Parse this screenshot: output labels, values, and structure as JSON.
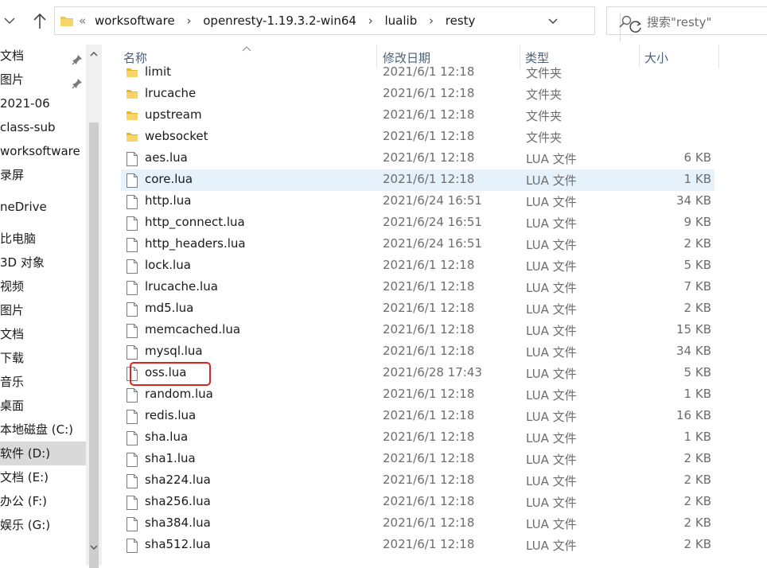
{
  "address_bar": {
    "overflow_chevron": "«",
    "crumbs": [
      "worksoftware",
      "openresty-1.19.3.2-win64",
      "lualib",
      "resty"
    ],
    "separator": "›"
  },
  "search": {
    "placeholder": "搜索\"resty\""
  },
  "navpane": {
    "items": [
      {
        "label": "文档",
        "pinned": true
      },
      {
        "label": "图片",
        "pinned": true
      },
      {
        "label": "2021-06",
        "pinned": false
      },
      {
        "label": "class-sub",
        "pinned": false
      },
      {
        "label": "worksoftware",
        "pinned": false
      },
      {
        "label": "录屏",
        "pinned": false
      },
      {
        "label": "neDrive",
        "pinned": false
      },
      {
        "label": "比电脑",
        "pinned": false
      },
      {
        "label": "3D 对象",
        "pinned": false
      },
      {
        "label": "视频",
        "pinned": false
      },
      {
        "label": "图片",
        "pinned": false
      },
      {
        "label": "文档",
        "pinned": false
      },
      {
        "label": "下载",
        "pinned": false
      },
      {
        "label": "音乐",
        "pinned": false
      },
      {
        "label": "桌面",
        "pinned": false
      },
      {
        "label": "本地磁盘 (C:)",
        "pinned": false
      },
      {
        "label": "软件 (D:)",
        "pinned": false,
        "selected": true
      },
      {
        "label": "文档 (E:)",
        "pinned": false
      },
      {
        "label": "办公 (F:)",
        "pinned": false
      },
      {
        "label": "娱乐 (G:)",
        "pinned": false
      }
    ]
  },
  "columns": {
    "name": "名称",
    "date": "修改日期",
    "type": "类型",
    "size": "大小"
  },
  "files": [
    {
      "name": "limit",
      "date": "2021/6/1 12:18",
      "type": "文件夹",
      "size": "",
      "kind": "folder"
    },
    {
      "name": "lrucache",
      "date": "2021/6/1 12:18",
      "type": "文件夹",
      "size": "",
      "kind": "folder"
    },
    {
      "name": "upstream",
      "date": "2021/6/1 12:18",
      "type": "文件夹",
      "size": "",
      "kind": "folder"
    },
    {
      "name": "websocket",
      "date": "2021/6/1 12:18",
      "type": "文件夹",
      "size": "",
      "kind": "folder"
    },
    {
      "name": "aes.lua",
      "date": "2021/6/1 12:18",
      "type": "LUA 文件",
      "size": "6 KB",
      "kind": "file"
    },
    {
      "name": "core.lua",
      "date": "2021/6/1 12:18",
      "type": "LUA 文件",
      "size": "1 KB",
      "kind": "file",
      "selected": true
    },
    {
      "name": "http.lua",
      "date": "2021/6/24 16:51",
      "type": "LUA 文件",
      "size": "34 KB",
      "kind": "file"
    },
    {
      "name": "http_connect.lua",
      "date": "2021/6/24 16:51",
      "type": "LUA 文件",
      "size": "9 KB",
      "kind": "file"
    },
    {
      "name": "http_headers.lua",
      "date": "2021/6/24 16:51",
      "type": "LUA 文件",
      "size": "2 KB",
      "kind": "file"
    },
    {
      "name": "lock.lua",
      "date": "2021/6/1 12:18",
      "type": "LUA 文件",
      "size": "5 KB",
      "kind": "file"
    },
    {
      "name": "lrucache.lua",
      "date": "2021/6/1 12:18",
      "type": "LUA 文件",
      "size": "7 KB",
      "kind": "file"
    },
    {
      "name": "md5.lua",
      "date": "2021/6/1 12:18",
      "type": "LUA 文件",
      "size": "2 KB",
      "kind": "file"
    },
    {
      "name": "memcached.lua",
      "date": "2021/6/1 12:18",
      "type": "LUA 文件",
      "size": "15 KB",
      "kind": "file"
    },
    {
      "name": "mysql.lua",
      "date": "2021/6/1 12:18",
      "type": "LUA 文件",
      "size": "34 KB",
      "kind": "file"
    },
    {
      "name": "oss.lua",
      "date": "2021/6/28 17:43",
      "type": "LUA 文件",
      "size": "5 KB",
      "kind": "file",
      "highlighted": true
    },
    {
      "name": "random.lua",
      "date": "2021/6/1 12:18",
      "type": "LUA 文件",
      "size": "1 KB",
      "kind": "file"
    },
    {
      "name": "redis.lua",
      "date": "2021/6/1 12:18",
      "type": "LUA 文件",
      "size": "16 KB",
      "kind": "file"
    },
    {
      "name": "sha.lua",
      "date": "2021/6/1 12:18",
      "type": "LUA 文件",
      "size": "1 KB",
      "kind": "file"
    },
    {
      "name": "sha1.lua",
      "date": "2021/6/1 12:18",
      "type": "LUA 文件",
      "size": "2 KB",
      "kind": "file"
    },
    {
      "name": "sha224.lua",
      "date": "2021/6/1 12:18",
      "type": "LUA 文件",
      "size": "2 KB",
      "kind": "file"
    },
    {
      "name": "sha256.lua",
      "date": "2021/6/1 12:18",
      "type": "LUA 文件",
      "size": "2 KB",
      "kind": "file"
    },
    {
      "name": "sha384.lua",
      "date": "2021/6/1 12:18",
      "type": "LUA 文件",
      "size": "2 KB",
      "kind": "file"
    },
    {
      "name": "sha512.lua",
      "date": "2021/6/1 12:18",
      "type": "LUA 文件",
      "size": "2 KB",
      "kind": "file"
    }
  ],
  "colors": {
    "selection": "#e5f1fb",
    "highlight_border": "#e3201b",
    "folder": "#f3c74b",
    "header_text": "#4c607a"
  }
}
